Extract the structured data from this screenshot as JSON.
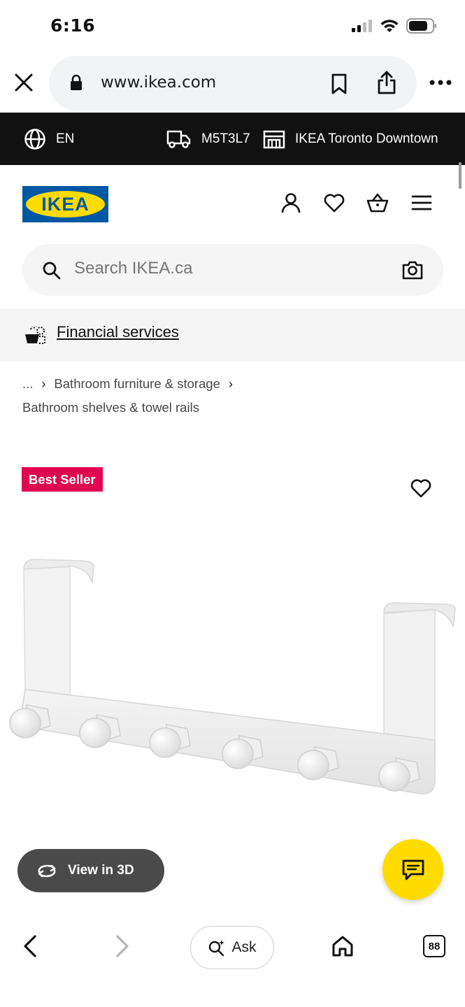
{
  "status": {
    "time": "6:16"
  },
  "browser": {
    "url": "www.ikea.com"
  },
  "top_bar": {
    "language": "EN",
    "postal_code": "M5T3L7",
    "store": "IKEA Toronto Downtown"
  },
  "header": {
    "logo_text": "IKEA"
  },
  "search": {
    "placeholder": "Search IKEA.ca"
  },
  "financial": {
    "label": "Financial services"
  },
  "breadcrumb": {
    "ellipsis": "...",
    "items": [
      "Bathroom furniture & storage",
      "Bathroom shelves & towel rails"
    ]
  },
  "product": {
    "badge": "Best Seller"
  },
  "view3d": {
    "label": "View in 3D"
  },
  "bottom_bar": {
    "ask_label": "Ask",
    "tab_count": "88"
  },
  "colors": {
    "ikea_blue": "#0058a3",
    "ikea_yellow": "#ffdb00",
    "badge_pink": "#e00751",
    "top_bar_bg": "#111111"
  }
}
